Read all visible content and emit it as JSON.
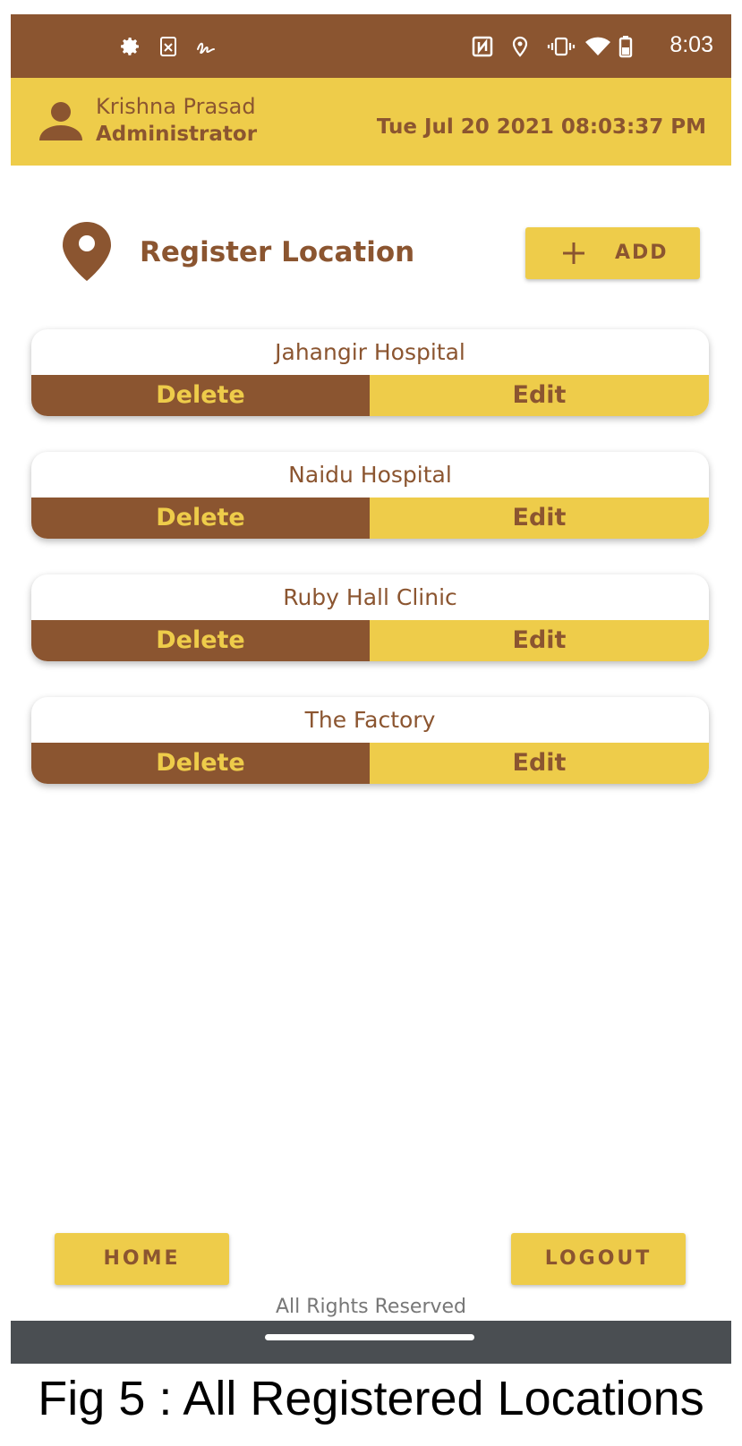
{
  "status_bar": {
    "time": "8:03",
    "icons": [
      "gear-icon",
      "sim-x-icon",
      "signature-icon",
      "nfc-icon",
      "location-icon",
      "vibrate-icon",
      "wifi-icon",
      "battery-icon"
    ],
    "background": "#8B5530"
  },
  "user_header": {
    "name": "Krishna Prasad",
    "role": "Administrator",
    "datetime": "Tue Jul 20 2021 08:03:37 PM",
    "background": "#EECC4A"
  },
  "page": {
    "title": "Register Location",
    "add_label": "ADD"
  },
  "locations": [
    {
      "name": "Jahangir Hospital",
      "delete_label": "Delete",
      "edit_label": "Edit"
    },
    {
      "name": "Naidu Hospital",
      "delete_label": "Delete",
      "edit_label": "Edit"
    },
    {
      "name": "Ruby Hall Clinic",
      "delete_label": "Delete",
      "edit_label": "Edit"
    },
    {
      "name": "The Factory",
      "delete_label": "Delete",
      "edit_label": "Edit"
    }
  ],
  "bottom": {
    "home_label": "HOME",
    "logout_label": "LOGOUT",
    "footer": "All Rights Reserved"
  },
  "caption": "Fig 5 : All Registered Locations",
  "colors": {
    "brown": "#8B5530",
    "yellow": "#EECC4A",
    "nav_bar": "#4A4E52"
  }
}
